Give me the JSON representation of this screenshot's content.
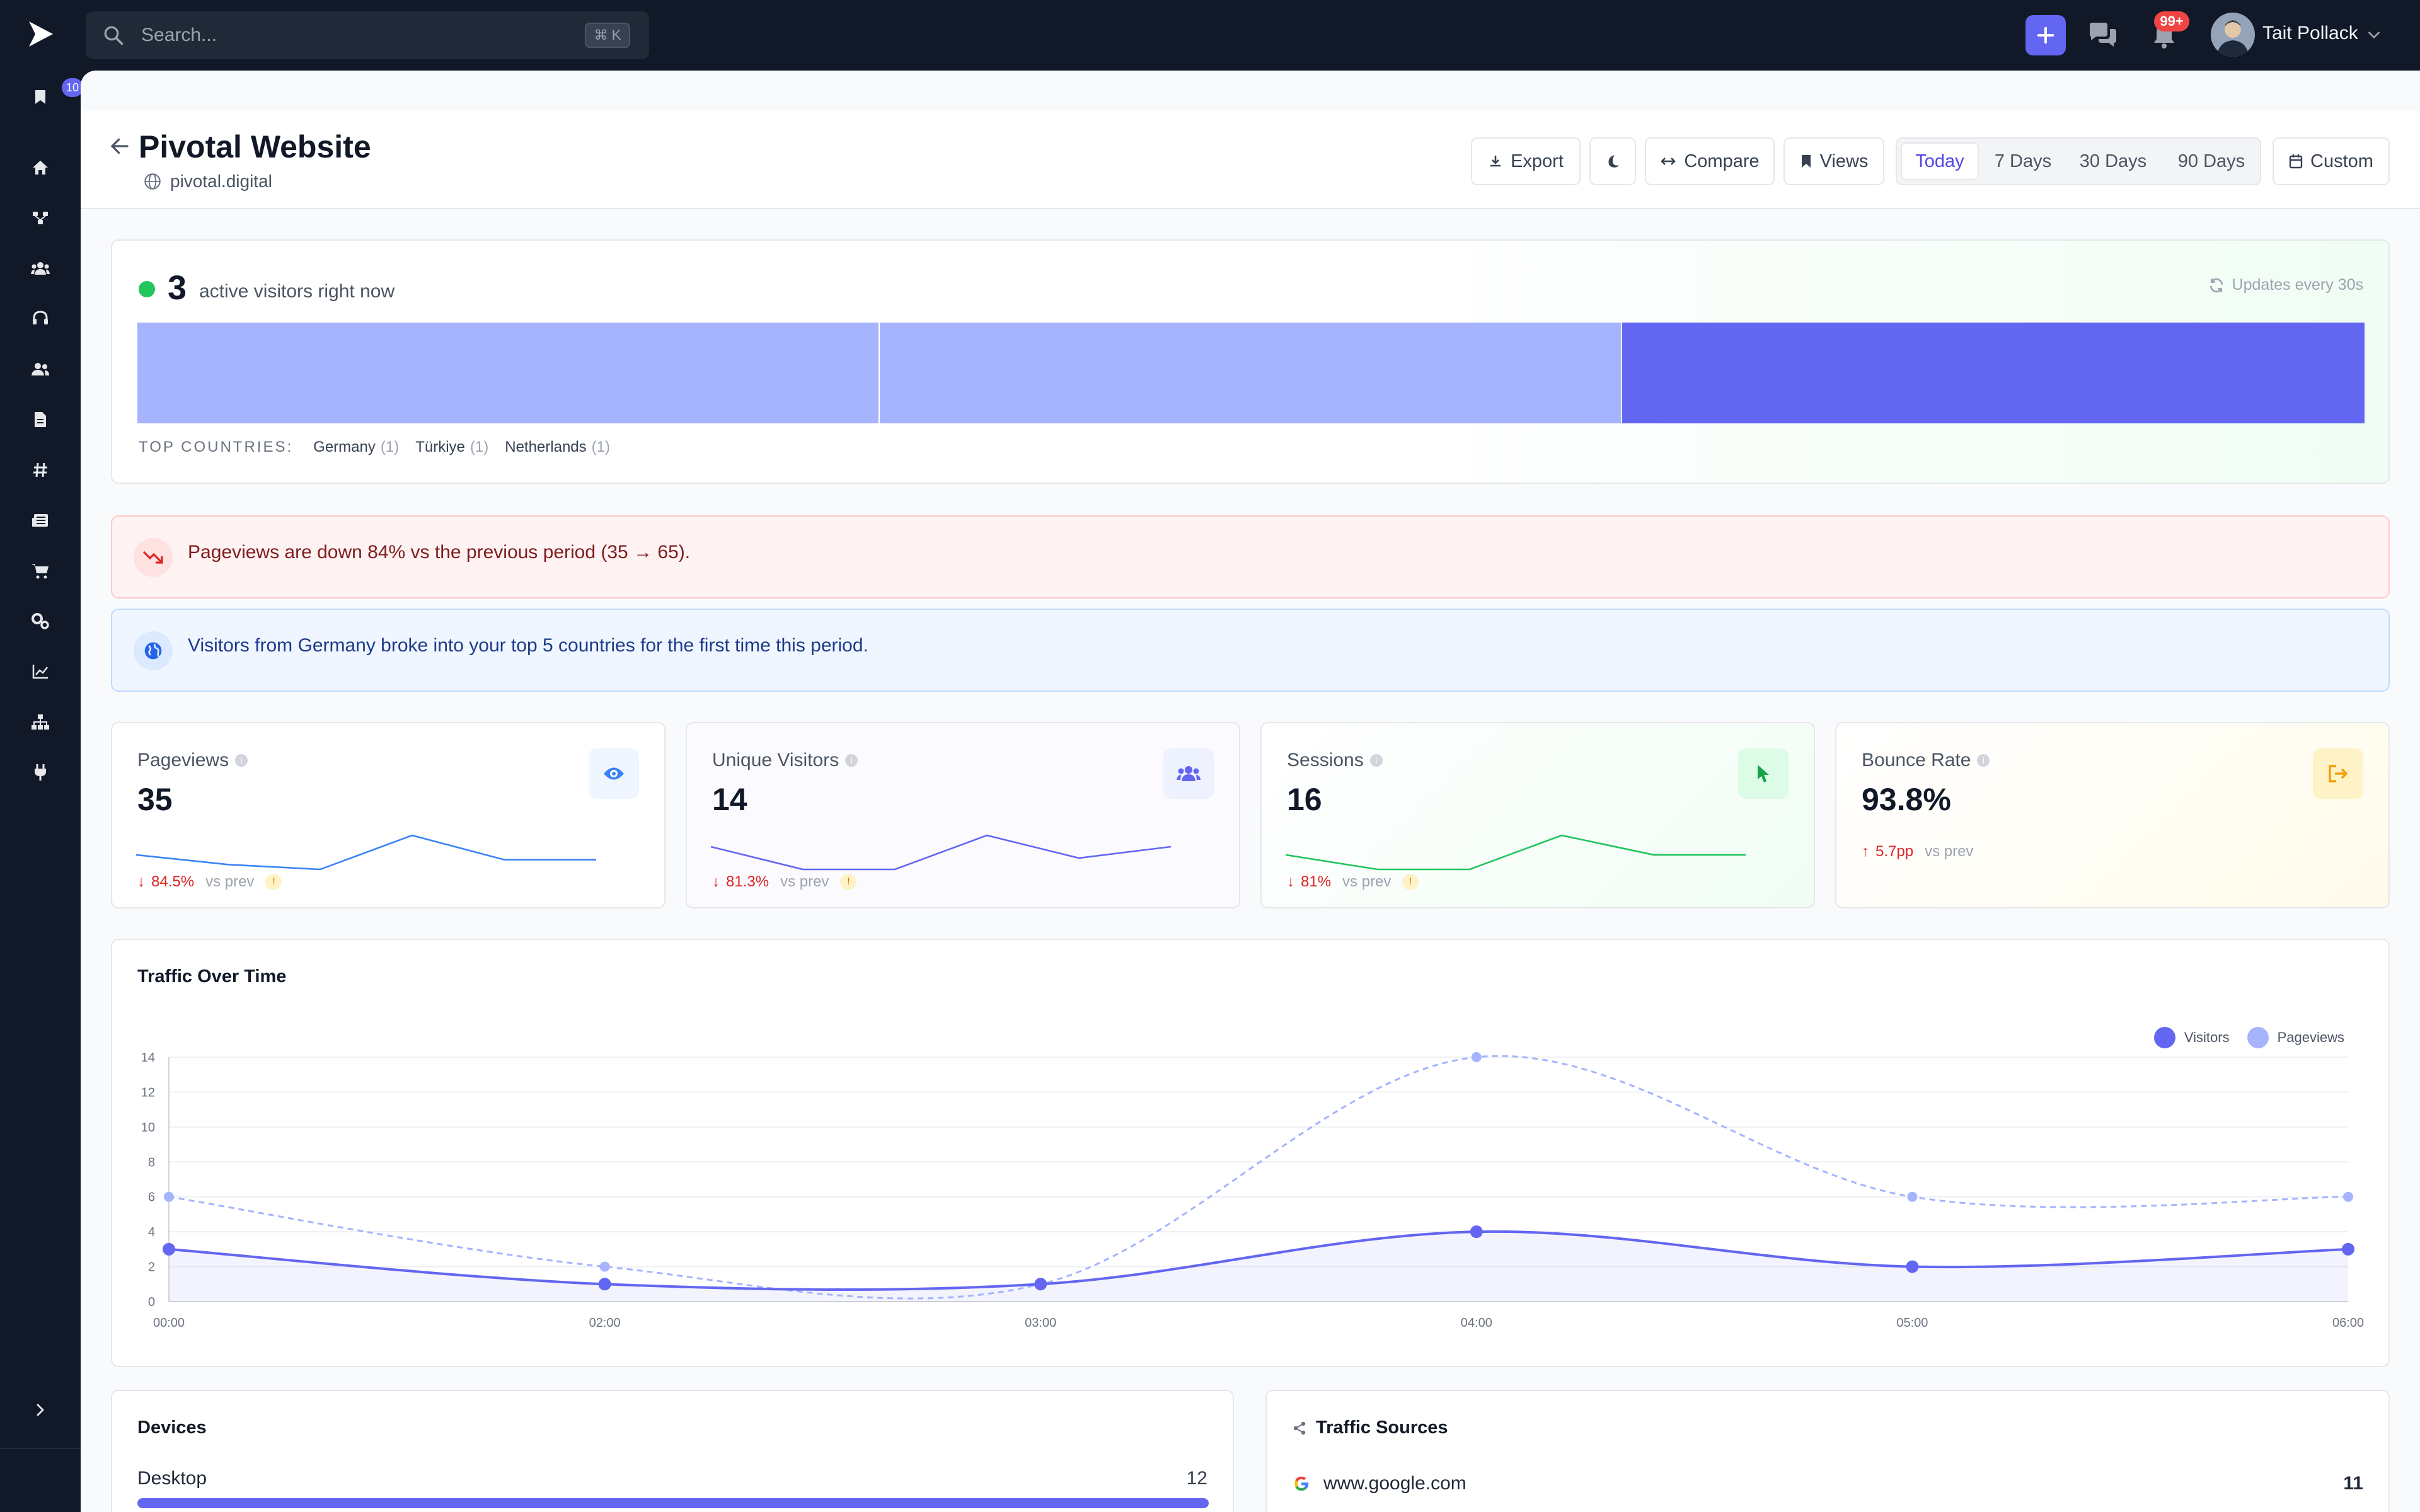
{
  "search": {
    "placeholder": "Search...",
    "shortcut": "⌘ K"
  },
  "topbar": {
    "notification_count": "99+",
    "user_name": "Tait Pollack"
  },
  "sidebar": {
    "bookmark_badge": "10",
    "icons": [
      "bookmark-icon",
      "home-icon",
      "flow-icon",
      "users-group-icon",
      "headset-icon",
      "user-icon",
      "document-icon",
      "hash-icon",
      "newspaper-icon",
      "cart-icon",
      "settings-icon",
      "chart-icon",
      "sitemap-icon",
      "plug-icon"
    ]
  },
  "header": {
    "title": "Pivotal Website",
    "domain": "pivotal.digital",
    "export_label": "Export",
    "compare_label": "Compare",
    "views_label": "Views",
    "ranges": [
      "Today",
      "7 Days",
      "30 Days",
      "90 Days"
    ],
    "active_range": "Today",
    "custom_label": "Custom"
  },
  "realtime": {
    "count": "3",
    "label": "active visitors right now",
    "update_note": "Updates every 30s",
    "top_countries_label": "TOP COUNTRIES:",
    "countries": [
      {
        "name": "Germany",
        "count": "(1)"
      },
      {
        "name": "Türkiye",
        "count": "(1)"
      },
      {
        "name": "Netherlands",
        "count": "(1)"
      }
    ],
    "bar_colors": [
      "#a5b4fc",
      "#a5b4fc",
      "#6366f1"
    ]
  },
  "alerts": {
    "pageviews_down": "Pageviews are down 84% vs the previous period (35 → 65).",
    "germany_top5": "Visitors from Germany broke into your top 5 countries for the first time this period."
  },
  "kpis": [
    {
      "label": "Pageviews",
      "value": "35",
      "delta": "84.5%",
      "prev": "vs prev",
      "color": "#3b82f6",
      "icon": "eye-icon",
      "spark": [
        5,
        3,
        2,
        9,
        4,
        4
      ]
    },
    {
      "label": "Unique Visitors",
      "value": "14",
      "delta": "81.3%",
      "prev": "vs prev",
      "color": "#6366f1",
      "icon": "users-icon",
      "spark": [
        6,
        2,
        2,
        8,
        4,
        6
      ]
    },
    {
      "label": "Sessions",
      "value": "16",
      "delta": "81%",
      "prev": "vs prev",
      "color": "#22c55e",
      "icon": "cursor-icon",
      "spark": [
        5,
        2,
        2,
        9,
        5,
        5
      ]
    },
    {
      "label": "Bounce Rate",
      "value": "93.8%",
      "delta": "5.7pp",
      "prev": "vs prev",
      "color": "#f59e0b",
      "icon": "exit-icon"
    }
  ],
  "traffic": {
    "title": "Traffic Over Time",
    "legend": [
      "Visitors",
      "Pageviews"
    ]
  },
  "chart_data": {
    "type": "line",
    "title": "Traffic Over Time",
    "x": [
      "00:00",
      "02:00",
      "03:00",
      "04:00",
      "05:00",
      "06:00"
    ],
    "series": [
      {
        "name": "Visitors",
        "values": [
          3,
          1,
          1,
          4,
          2,
          3
        ],
        "color": "#6366f1"
      },
      {
        "name": "Pageviews",
        "values": [
          6,
          2,
          1,
          14,
          6,
          6
        ],
        "color": "#a5b4fc"
      }
    ],
    "yticks": [
      0,
      2,
      4,
      6,
      8,
      10,
      12,
      14
    ],
    "ylim": [
      0,
      14
    ],
    "grid": true,
    "legend": "top-right"
  },
  "devices": {
    "title": "Devices",
    "items": [
      {
        "label": "Desktop",
        "value": "12",
        "share": 1.0
      }
    ]
  },
  "sources": {
    "title": "Traffic Sources",
    "items": [
      {
        "label": "www.google.com",
        "value": "11"
      }
    ]
  }
}
